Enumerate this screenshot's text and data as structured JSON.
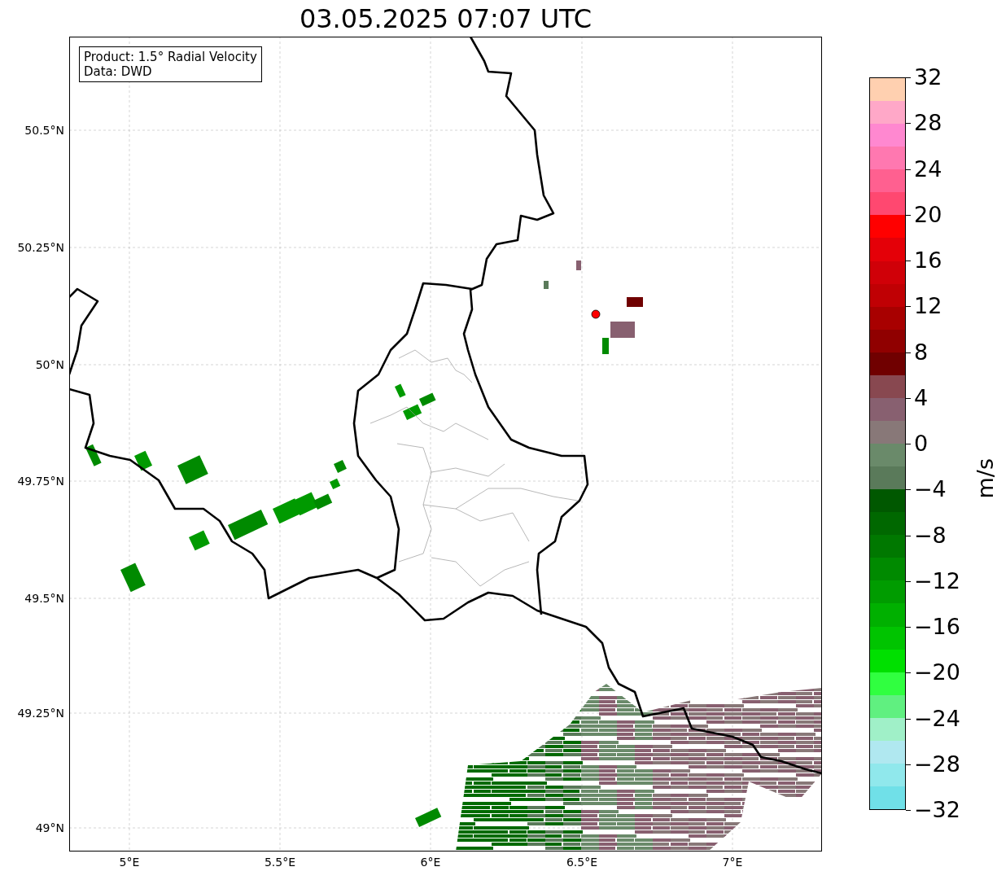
{
  "title": "03.05.2025 07:07 UTC",
  "legend": {
    "lines": [
      "Product: 1.5° Radial Velocity",
      "Data: DWD"
    ]
  },
  "map": {
    "lat_labels": [
      "50.5°N",
      "50.25°N",
      "50°N",
      "49.75°N",
      "49.5°N",
      "49.25°N",
      "49°N"
    ],
    "lon_labels": [
      "5°E",
      "5.5°E",
      "6°E",
      "6.5°E",
      "7°E"
    ]
  },
  "colorbar": {
    "label": "m/s",
    "tick_labels": [
      "32",
      "28",
      "24",
      "20",
      "16",
      "12",
      "8",
      "4",
      "0",
      "−4",
      "−8",
      "−12",
      "−16",
      "−20",
      "−24",
      "−28",
      "−32"
    ],
    "bands": [
      {
        "color": "#ffd0b0"
      },
      {
        "color": "#ffa8c8"
      },
      {
        "color": "#ff88d0"
      },
      {
        "color": "#ff78b0"
      },
      {
        "color": "#ff6090"
      },
      {
        "color": "#ff4870"
      },
      {
        "color": "#ff0000"
      },
      {
        "color": "#e40008"
      },
      {
        "color": "#d00008"
      },
      {
        "color": "#c00004"
      },
      {
        "color": "#a80000"
      },
      {
        "color": "#900000"
      },
      {
        "color": "#700000"
      },
      {
        "color": "#884850"
      },
      {
        "color": "#886070"
      },
      {
        "color": "#887878"
      },
      {
        "color": "#6a8a6a"
      },
      {
        "color": "#5a7a5a"
      },
      {
        "color": "#005800"
      },
      {
        "color": "#006800"
      },
      {
        "color": "#007800"
      },
      {
        "color": "#008a00"
      },
      {
        "color": "#009c00"
      },
      {
        "color": "#00b000"
      },
      {
        "color": "#00c400"
      },
      {
        "color": "#00e000"
      },
      {
        "color": "#30ff40"
      },
      {
        "color": "#60f080"
      },
      {
        "color": "#a0f0c8"
      },
      {
        "color": "#b0e8f0"
      },
      {
        "color": "#90e8ec"
      },
      {
        "color": "#70e0e8"
      }
    ]
  }
}
